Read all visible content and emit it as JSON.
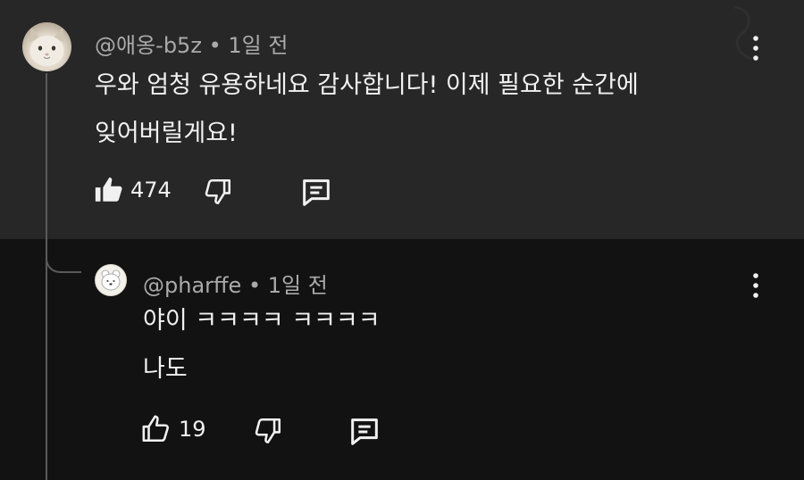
{
  "comment": {
    "handle": "@애옹-b5z",
    "time": "• 1일 전",
    "text_line1": "우와 엄청 유용하네요 감사합니다! 이제 필요한 순간에",
    "text_line2": "잊어버릴게요!",
    "like_count": "474",
    "avatar_icon": "cat-photo-avatar",
    "icons": {
      "like": "thumbs-up-filled-icon",
      "dislike": "thumbs-down-icon",
      "reply": "reply-comment-icon",
      "menu": "more-vertical-icon"
    }
  },
  "reply": {
    "handle": "@pharffe",
    "time": "• 1일 전",
    "text_line1": "야이 ㅋㅋㅋㅋ ㅋㅋㅋㅋ",
    "text_line2": "나도",
    "like_count": "19",
    "avatar_icon": "bear-cartoon-avatar",
    "icons": {
      "like": "thumbs-up-outline-icon",
      "dislike": "thumbs-down-icon",
      "reply": "reply-comment-icon",
      "menu": "more-vertical-icon"
    }
  },
  "colors": {
    "top_background": "#272727",
    "bottom_background": "#121212",
    "text_primary": "#f1f1f1",
    "text_secondary": "#aaaaaa",
    "thread_line": "#5a5a5a"
  }
}
